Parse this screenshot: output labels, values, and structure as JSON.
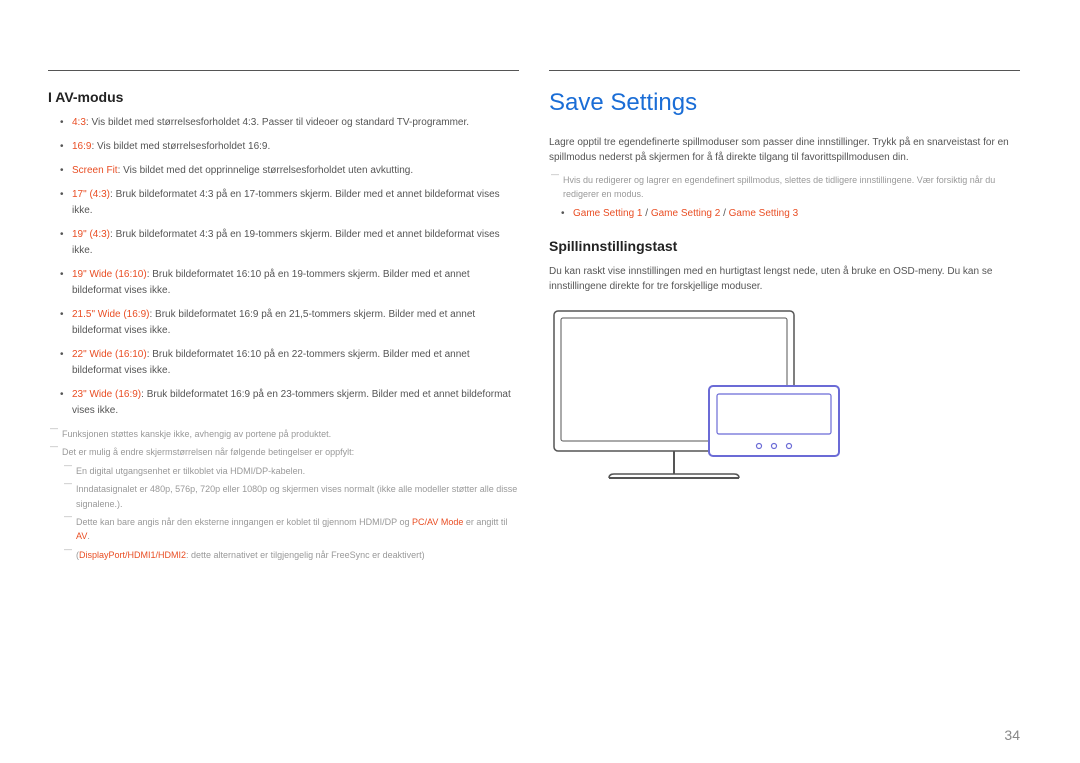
{
  "left": {
    "heading": "I AV-modus",
    "bullets": [
      {
        "term": "4:3",
        "text": ": Vis bildet med størrelsesforholdet 4:3. Passer til videoer og standard TV-programmer."
      },
      {
        "term": "16:9",
        "text": ": Vis bildet med størrelsesforholdet 16:9."
      },
      {
        "term": "Screen Fit",
        "text": ": Vis bildet med det opprinnelige størrelsesforholdet uten avkutting."
      },
      {
        "term": "17\" (4:3)",
        "text": ": Bruk bildeformatet 4:3 på en 17-tommers skjerm. Bilder med et annet bildeformat vises ikke."
      },
      {
        "term": "19\" (4:3)",
        "text": ": Bruk bildeformatet 4:3 på en 19-tommers skjerm. Bilder med et annet bildeformat vises ikke."
      },
      {
        "term": "19\" Wide (16:10)",
        "text": ": Bruk bildeformatet 16:10 på en 19-tommers skjerm. Bilder med et annet bildeformat vises ikke."
      },
      {
        "term": "21.5\" Wide (16:9)",
        "text": ": Bruk bildeformatet 16:9 på en 21,5-tommers skjerm. Bilder med et annet bildeformat vises ikke."
      },
      {
        "term": "22\" Wide (16:10)",
        "text": ": Bruk bildeformatet 16:10 på en 22-tommers skjerm. Bilder med et annet bildeformat vises ikke."
      },
      {
        "term": "23\" Wide (16:9)",
        "text": ": Bruk bildeformatet 16:9 på en 23-tommers skjerm. Bilder med et annet bildeformat vises ikke."
      }
    ],
    "footnotes": {
      "f1": "Funksjonen støttes kanskje ikke, avhengig av portene på produktet.",
      "f2": "Det er mulig å endre skjermstørrelsen når følgende betingelser er oppfylt:",
      "f2a": "En digital utgangsenhet er tilkoblet via HDMI/DP-kabelen.",
      "f2b": "Inndatasignalet er 480p, 576p, 720p eller 1080p og skjermen vises normalt (ikke alle modeller støtter alle disse signalene.).",
      "f2c_pre": "Dette kan bare angis når den eksterne inngangen er koblet til gjennom HDMI/DP og ",
      "f2c_mode": "PC/AV Mode",
      "f2c_mid": " er angitt til ",
      "f2c_av": "AV",
      "f2c_post": ".",
      "f2c2_open": "(",
      "f2c2_ports": "DisplayPort/HDMI1/HDMI2",
      "f2c2_mid": ": dette alternativet er tilgjengelig når ",
      "f2c2_fs": "FreeSync",
      "f2c2_post": " er deaktivert)"
    }
  },
  "right": {
    "title": "Save Settings",
    "intro": "Lagre opptil tre egendefinerte spillmoduser som passer dine innstillinger. Trykk på en snarveistast for en spillmodus nederst på skjermen for å få direkte tilgang til favorittspillmodusen din.",
    "footnote": "Hvis du redigerer og lagrer en egendefinert spillmodus, slettes de tidligere innstillingene. Vær forsiktig når du redigerer en modus.",
    "game_settings": {
      "gs1": "Game Setting 1",
      "sep1": " / ",
      "gs2": "Game Setting 2",
      "sep2": " / ",
      "gs3": "Game Setting 3"
    },
    "subheading": "Spillinnstillingstast",
    "subtext": "Du kan raskt vise innstillingen med en hurtigtast lengst nede, uten å bruke en OSD-meny. Du kan se innstillingene direkte for tre forskjellige moduser."
  },
  "page_number": "34"
}
